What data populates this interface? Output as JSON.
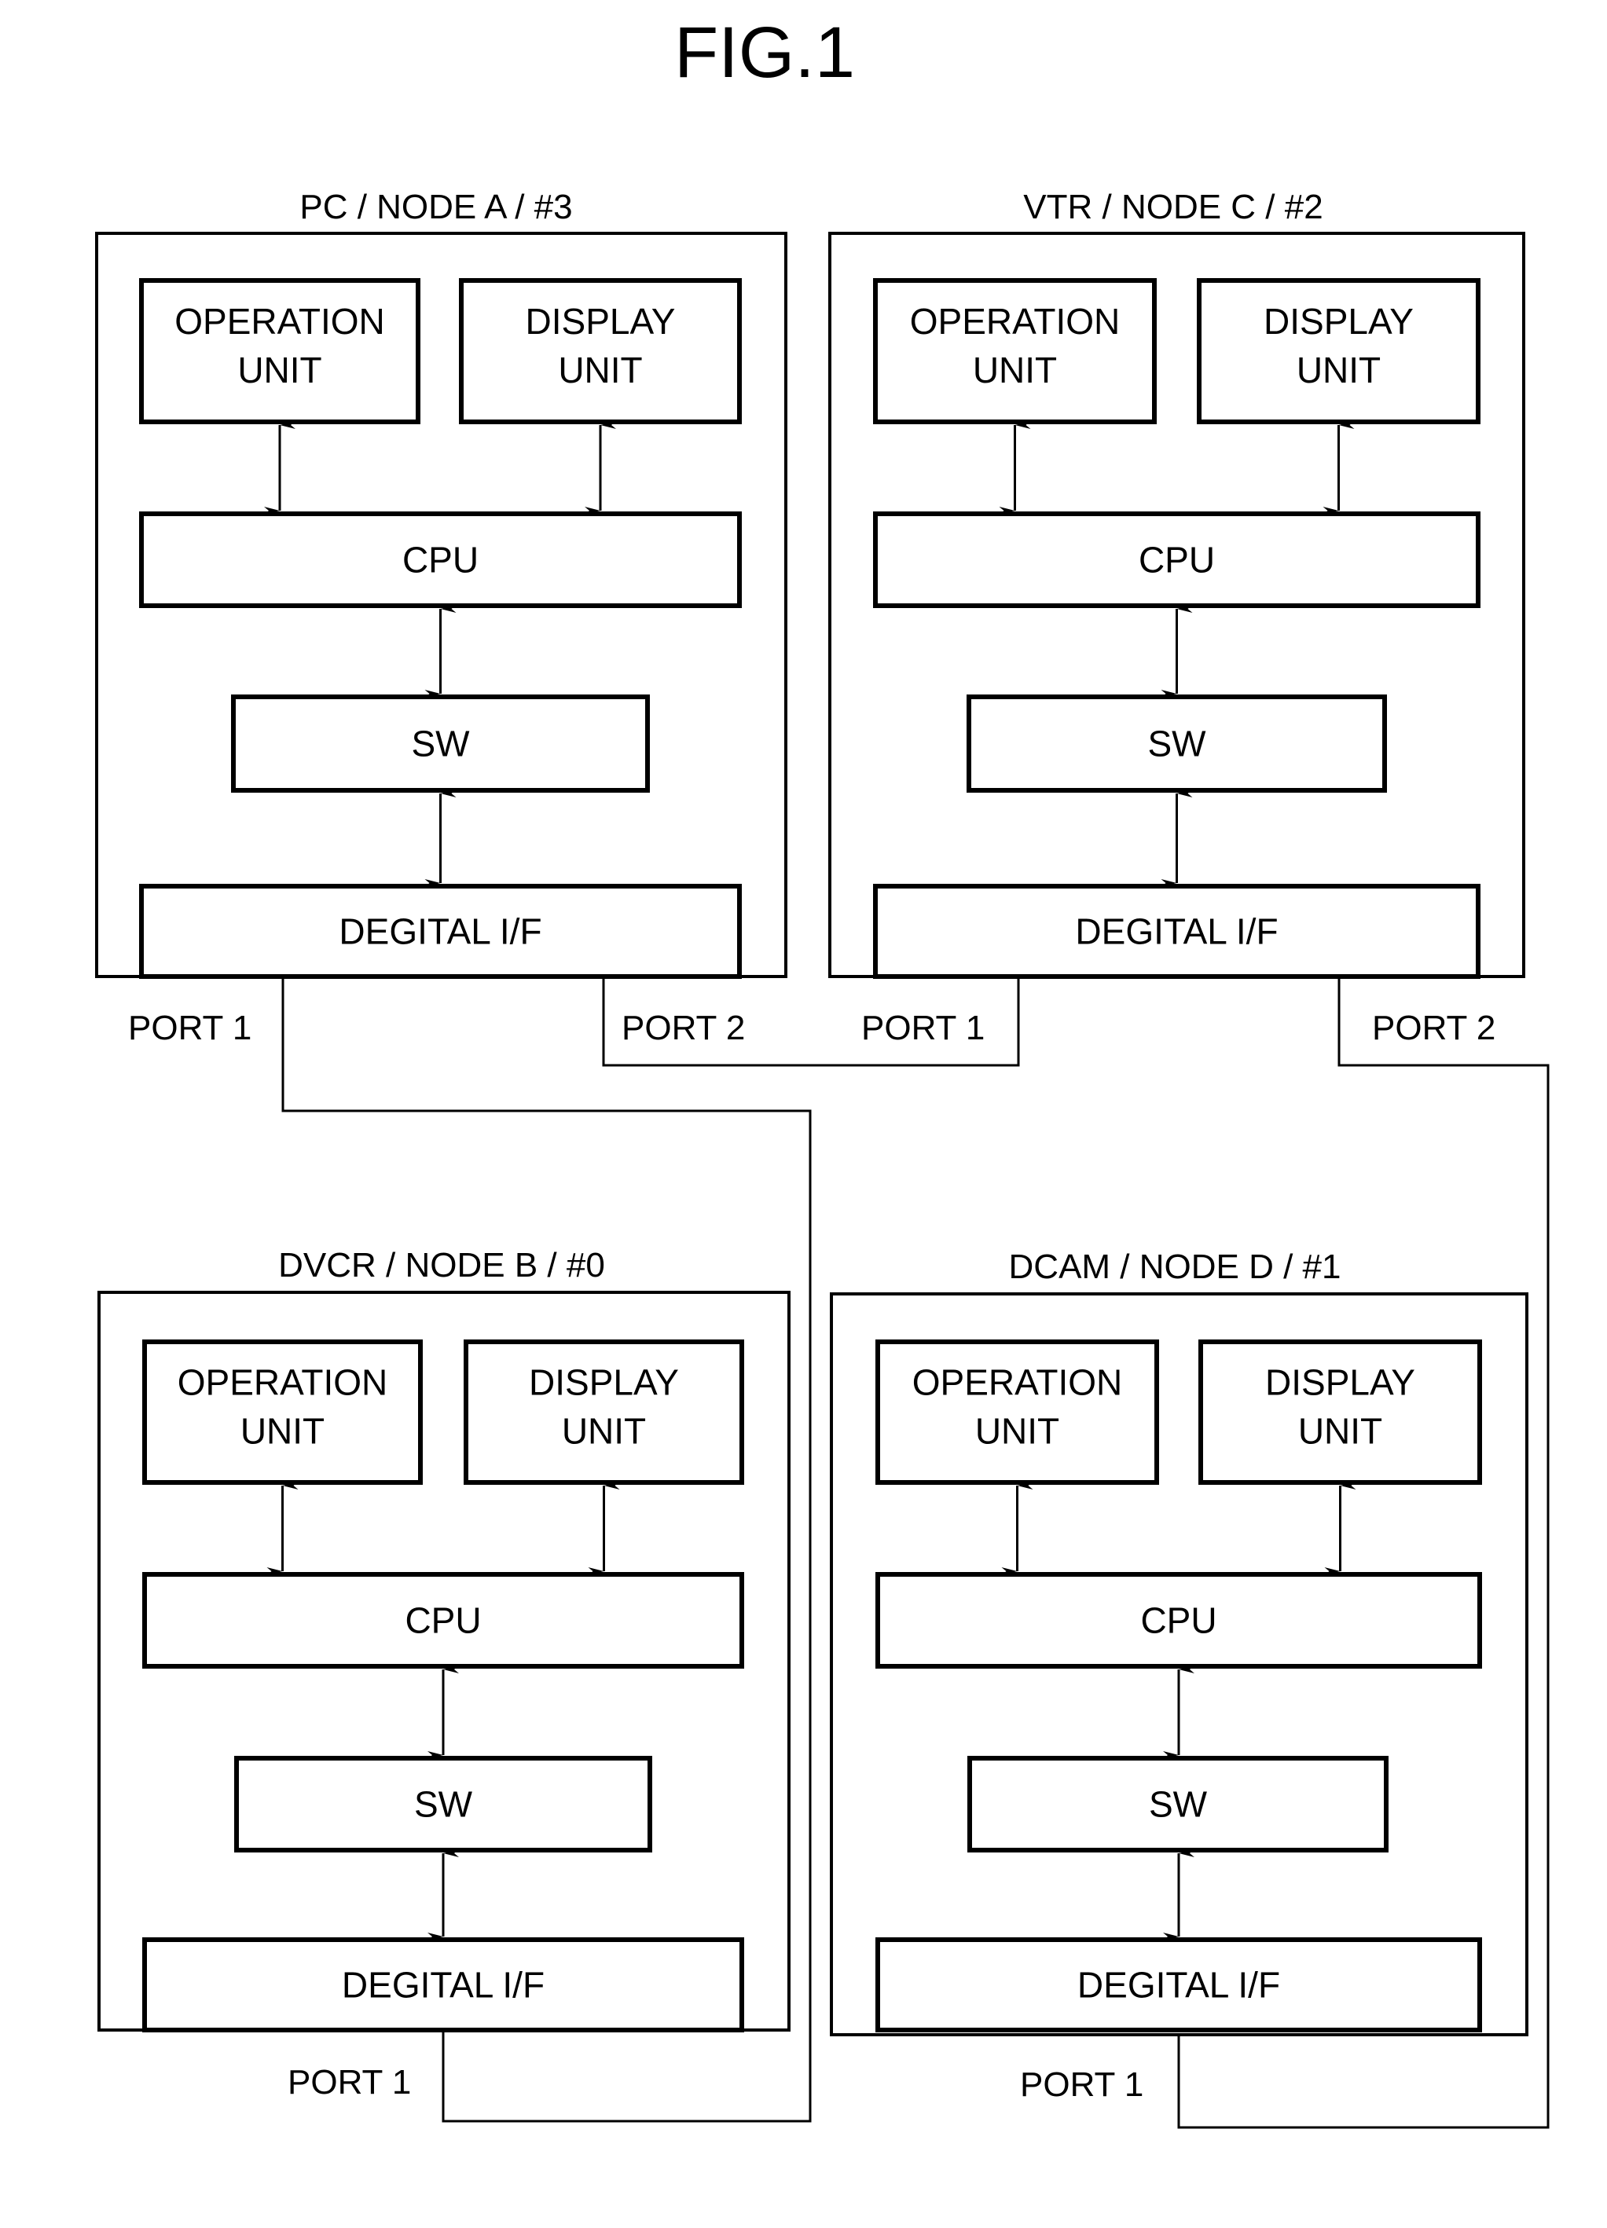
{
  "figure": {
    "title": "FIG.1"
  },
  "nodes": [
    {
      "id": "A",
      "label": "PC / NODE A / #3",
      "blocks": {
        "operation": [
          "OPERATION",
          "UNIT"
        ],
        "display": [
          "DISPLAY",
          "UNIT"
        ],
        "cpu": "CPU",
        "sw": "SW",
        "dif": "DEGITAL  I/F"
      },
      "ports": [
        "PORT 1",
        "PORT 2"
      ]
    },
    {
      "id": "C",
      "label": "VTR / NODE C / #2",
      "blocks": {
        "operation": [
          "OPERATION",
          "UNIT"
        ],
        "display": [
          "DISPLAY",
          "UNIT"
        ],
        "cpu": "CPU",
        "sw": "SW",
        "dif": "DEGITAL  I/F"
      },
      "ports": [
        "PORT 1",
        "PORT 2"
      ]
    },
    {
      "id": "B",
      "label": "DVCR / NODE B / #0",
      "blocks": {
        "operation": [
          "OPERATION",
          "UNIT"
        ],
        "display": [
          "DISPLAY",
          "UNIT"
        ],
        "cpu": "CPU",
        "sw": "SW",
        "dif": "DEGITAL  I/F"
      },
      "ports": [
        "PORT 1"
      ]
    },
    {
      "id": "D",
      "label": "DCAM / NODE D / #1",
      "blocks": {
        "operation": [
          "OPERATION",
          "UNIT"
        ],
        "display": [
          "DISPLAY",
          "UNIT"
        ],
        "cpu": "CPU",
        "sw": "SW",
        "dif": "DEGITAL  I/F"
      },
      "ports": [
        "PORT 1"
      ]
    }
  ],
  "connections": [
    {
      "from": "NODE A PORT 1",
      "to": "NODE B PORT 1"
    },
    {
      "from": "NODE A PORT 2",
      "to": "NODE C PORT 1"
    },
    {
      "from": "NODE C PORT 2",
      "to": "NODE D PORT 1"
    }
  ]
}
